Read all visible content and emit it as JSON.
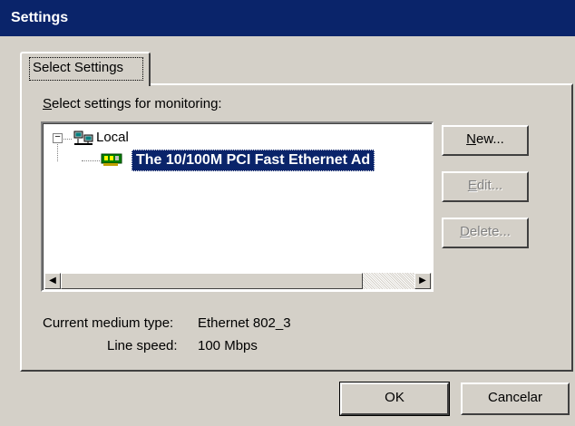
{
  "window": {
    "title": "Settings"
  },
  "tab": {
    "label": "Select Settings"
  },
  "prompt": {
    "prefix": "S",
    "rest": "elect settings for monitoring:"
  },
  "tree": {
    "root": {
      "label": "Local",
      "expander": "−",
      "icon": "network-computer-icon"
    },
    "child": {
      "label": "The 10/100M PCI Fast Ethernet Ad",
      "icon": "network-card-icon"
    }
  },
  "scroll": {
    "left_arrow": "◀",
    "right_arrow": "▶"
  },
  "side_buttons": {
    "new": {
      "prefix": "N",
      "rest": "ew..."
    },
    "edit": {
      "prefix": "E",
      "rest": "dit..."
    },
    "delete": {
      "prefix": "D",
      "rest": "elete..."
    }
  },
  "info": {
    "medium_label": "Current medium type:",
    "medium_value": "Ethernet 802_3",
    "speed_label": "Line speed:",
    "speed_value": "100 Mbps"
  },
  "footer": {
    "ok": "OK",
    "cancel": "Cancelar"
  },
  "colors": {
    "title_bg": "#0a246a",
    "face": "#d4d0c8",
    "selection": "#0a246a"
  }
}
